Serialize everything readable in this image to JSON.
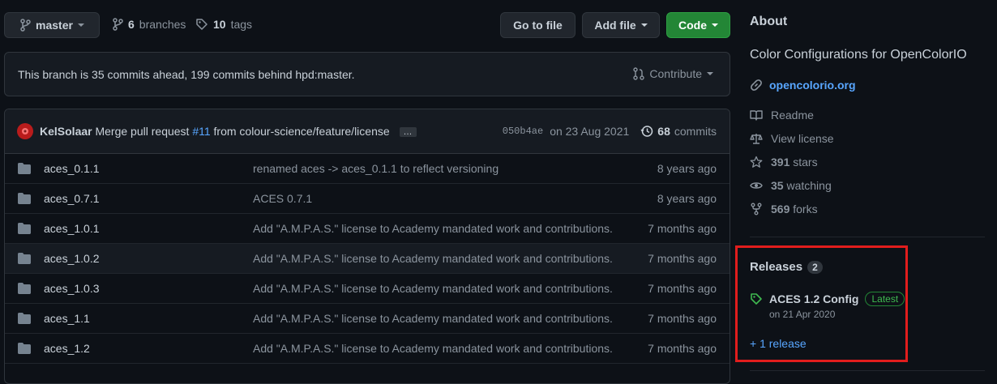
{
  "toolbar": {
    "branch": "master",
    "branches_count": "6",
    "branches_label": "branches",
    "tags_count": "10",
    "tags_label": "tags",
    "goto_file": "Go to file",
    "add_file": "Add file",
    "code": "Code"
  },
  "compare": {
    "text": "This branch is 35 commits ahead, 199 commits behind hpd:master.",
    "contribute": "Contribute"
  },
  "latest_commit": {
    "author": "KelSolaar",
    "message_prefix": "Merge pull request",
    "pr": "#11",
    "message_suffix": "from colour-science/feature/license",
    "ellipsis": "…",
    "sha": "050b4ae",
    "date": "on 23 Aug 2021",
    "commits_count": "68",
    "commits_label": "commits"
  },
  "files": [
    {
      "name": "aces_0.1.1",
      "message": "renamed aces -> aces_0.1.1 to reflect versioning",
      "age": "8 years ago"
    },
    {
      "name": "aces_0.7.1",
      "message": "ACES 0.7.1",
      "age": "8 years ago"
    },
    {
      "name": "aces_1.0.1",
      "message": "Add \"A.M.P.A.S.\" license to Academy mandated work and contributions.",
      "age": "7 months ago"
    },
    {
      "name": "aces_1.0.2",
      "message": "Add \"A.M.P.A.S.\" license to Academy mandated work and contributions.",
      "age": "7 months ago"
    },
    {
      "name": "aces_1.0.3",
      "message": "Add \"A.M.P.A.S.\" license to Academy mandated work and contributions.",
      "age": "7 months ago"
    },
    {
      "name": "aces_1.1",
      "message": "Add \"A.M.P.A.S.\" license to Academy mandated work and contributions.",
      "age": "7 months ago"
    },
    {
      "name": "aces_1.2",
      "message": "Add \"A.M.P.A.S.\" license to Academy mandated work and contributions.",
      "age": "7 months ago"
    }
  ],
  "about": {
    "title": "About",
    "description": "Color Configurations for OpenColorIO",
    "website": "opencolorio.org",
    "readme": "Readme",
    "license": "View license",
    "stars_count": "391",
    "stars_label": "stars",
    "watching_count": "35",
    "watching_label": "watching",
    "forks_count": "569",
    "forks_label": "forks"
  },
  "releases": {
    "title": "Releases",
    "count": "2",
    "latest_name": "ACES 1.2 Config",
    "latest_badge": "Latest",
    "latest_date": "on 21 Apr 2020",
    "more": "+ 1 release"
  },
  "colors": {
    "background": "#0d1117",
    "accent_link": "#58a6ff",
    "code_button": "#238636",
    "highlight_box": "#e11d1d"
  }
}
